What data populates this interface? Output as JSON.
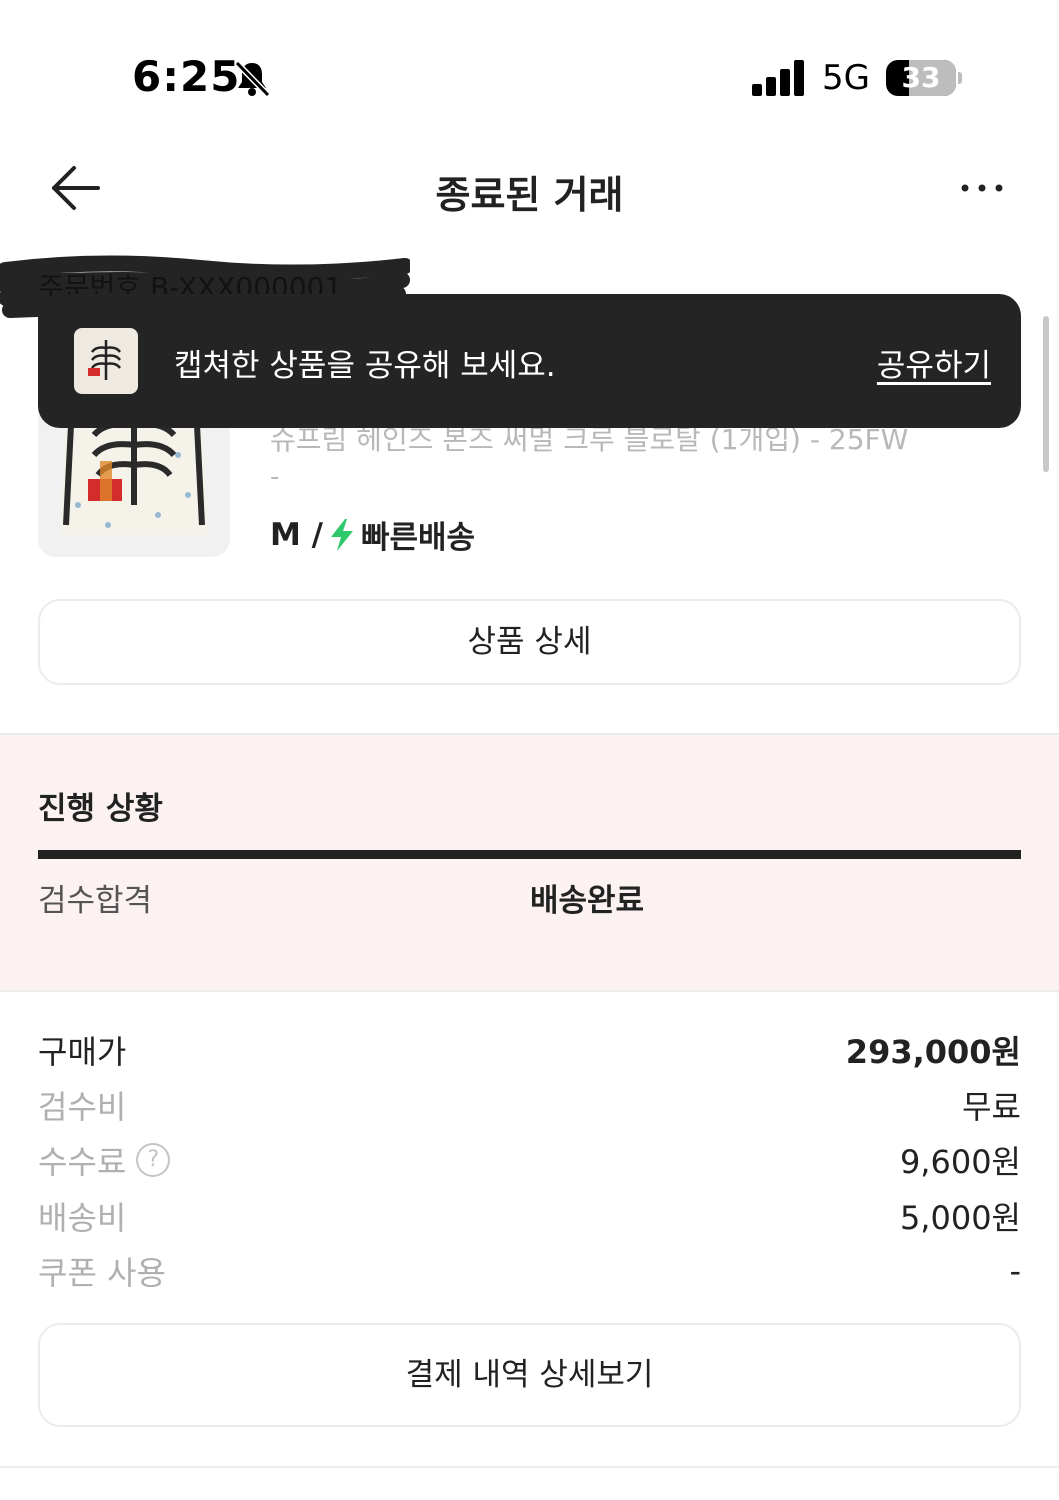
{
  "status_bar": {
    "time": "6:25",
    "network": "5G",
    "battery": "33",
    "battery_level": 0.33
  },
  "header": {
    "title": "종료된 거래"
  },
  "product": {
    "order_number": "주문번호 B-XXX000001",
    "name": "슈프림 헤인즈 본즈 써멀 크루 블로탈 (1개입) - 25FW",
    "dash": "-",
    "size": "M /",
    "shipping_label": "빠른배송",
    "detail_button": "상품 상세"
  },
  "toast": {
    "message": "캡쳐한 상품을 공유해 보세요.",
    "action": "공유하기"
  },
  "progress": {
    "title": "진행 상황",
    "steps": [
      "검수합격",
      "배송완료"
    ]
  },
  "prices": [
    {
      "label": "구매가",
      "value": "293,000원"
    },
    {
      "label": "검수비",
      "value": "무료"
    },
    {
      "label": "수수료",
      "value": "9,600원",
      "help": "?"
    },
    {
      "label": "배송비",
      "value": "5,000원"
    },
    {
      "label": "쿠폰 사용",
      "value": "-"
    }
  ],
  "payment_button": "결제 내역 상세보기",
  "colors": {
    "toast_bg": "#242424",
    "progress_bg": "#fdf2f2",
    "bolt": "#2ec96b",
    "text": "#222222",
    "muted": "#b0b0b0"
  }
}
